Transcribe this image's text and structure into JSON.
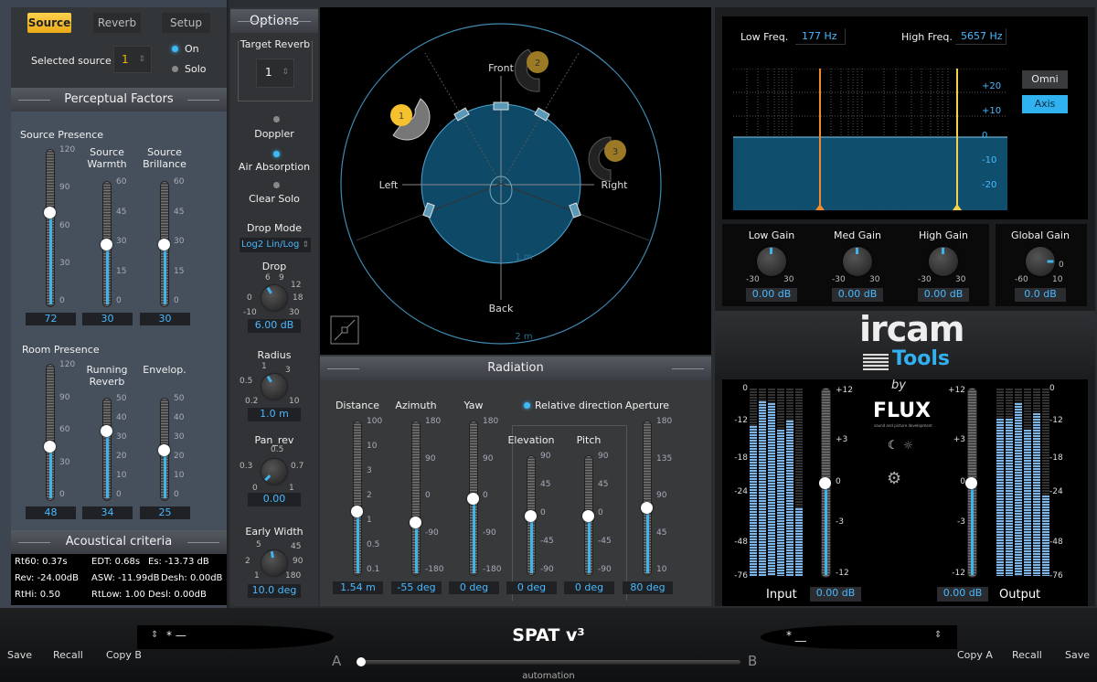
{
  "source_panel": {
    "tabs": [
      {
        "label": "Source",
        "active": true
      },
      {
        "label": "Reverb",
        "active": false
      },
      {
        "label": "Setup",
        "active": false
      }
    ],
    "selected_source_label": "Selected source",
    "selected_source_value": "1",
    "radio_on": "On",
    "radio_solo": "Solo",
    "perceptual_title": "Perceptual Factors",
    "sliders_top": [
      {
        "label": "Source Presence",
        "ticks": [
          "120",
          "90",
          "60",
          "30",
          "0"
        ],
        "value": "72",
        "fraction": 0.6
      },
      {
        "label": "Source Warmth",
        "ticks": [
          "60",
          "45",
          "30",
          "15",
          "0"
        ],
        "value": "30",
        "fraction": 0.5
      },
      {
        "label": "Source Brillance",
        "ticks": [
          "60",
          "45",
          "30",
          "15",
          "0"
        ],
        "value": "30",
        "fraction": 0.5
      }
    ],
    "sliders_bottom": [
      {
        "label": "Room Presence",
        "ticks": [
          "120",
          "90",
          "60",
          "30",
          "0"
        ],
        "value": "48",
        "fraction": 0.4
      },
      {
        "label": "Running Reverb",
        "ticks": [
          "50",
          "40",
          "30",
          "20",
          "10",
          "0"
        ],
        "value": "34",
        "fraction": 0.68
      },
      {
        "label": "Envelop.",
        "ticks": [
          "50",
          "40",
          "30",
          "20",
          "10",
          "0"
        ],
        "value": "25",
        "fraction": 0.5
      }
    ],
    "acoustical_title": "Acoustical criteria",
    "criteria": [
      [
        "Rt60: 0.37s",
        "EDT: 0.68s",
        "Es: -13.73 dB"
      ],
      [
        "Rev: -24.00dB",
        "ASW: -11.99dB",
        "Desh: 0.00dB"
      ],
      [
        "RtHi: 0.50",
        "RtLow: 1.00",
        "Desl: 0.00dB"
      ]
    ]
  },
  "options": {
    "title": "Options",
    "target_reverb_label": "Target Reverb",
    "target_reverb_value": "1",
    "doppler": "Doppler",
    "air_absorption": "Air Absorption",
    "clear_solo": "Clear Solo",
    "drop_mode_label": "Drop Mode",
    "drop_mode_value": "Log2 Lin/Log",
    "knobs": [
      {
        "label": "Drop",
        "ticks": [
          "6",
          "9",
          "0",
          "12",
          "18",
          "-10",
          "30"
        ],
        "value": "6.00 dB"
      },
      {
        "label": "Radius",
        "ticks": [
          "1",
          "3",
          "0.5",
          "0.2",
          "10"
        ],
        "value": "1.0 m"
      },
      {
        "label": "Pan_rev",
        "ticks": [
          "0.5",
          "0.3",
          "0.7",
          "0",
          "1"
        ],
        "value": "0.00"
      },
      {
        "label": "Early Width",
        "ticks": [
          "5",
          "45",
          "2",
          "90",
          "1",
          "180"
        ],
        "value": "10.0 deg"
      }
    ]
  },
  "spatial_view": {
    "labels": {
      "front": "Front",
      "back": "Back",
      "left": "Left",
      "right": "Right"
    },
    "ring_labels": [
      "1 m",
      "2 m"
    ],
    "sources": [
      "1",
      "2",
      "3"
    ]
  },
  "radiation": {
    "title": "Radiation",
    "relative_direction": "Relative direction",
    "sliders": [
      {
        "label": "Distance",
        "ticks": [
          "100",
          "10",
          "3",
          "2",
          "1",
          "0.5",
          "0.1"
        ],
        "value": "1.54 m",
        "fraction": 0.42
      },
      {
        "label": "Azimuth",
        "ticks": [
          "180",
          "90",
          "0",
          "-90",
          "-180"
        ],
        "value": "-55 deg",
        "fraction": 0.35
      },
      {
        "label": "Yaw",
        "ticks": [
          "180",
          "90",
          "0",
          "-90",
          "-180"
        ],
        "value": "0 deg",
        "fraction": 0.5
      },
      {
        "label": "Elevation",
        "ticks": [
          "90",
          "45",
          "0",
          "-45",
          "-90"
        ],
        "value": "0 deg",
        "fraction": 0.5
      },
      {
        "label": "Pitch",
        "ticks": [
          "90",
          "45",
          "0",
          "-45",
          "-90"
        ],
        "value": "0 deg",
        "fraction": 0.5
      },
      {
        "label": "Aperture",
        "ticks": [
          "180",
          "135",
          "90",
          "45",
          "10"
        ],
        "value": "80 deg",
        "fraction": 0.44
      }
    ]
  },
  "eq": {
    "low_freq_label": "Low Freq.",
    "low_freq_value": "177 Hz",
    "high_freq_label": "High Freq.",
    "high_freq_value": "5657 Hz",
    "db_ticks": [
      "+20",
      "+10",
      "0",
      "-10",
      "-20"
    ],
    "omni": "Omni",
    "axis": "Axis",
    "gains": [
      {
        "label": "Low Gain",
        "min": "-30",
        "max": "30",
        "value": "0.00 dB"
      },
      {
        "label": "Med Gain",
        "min": "-30",
        "max": "30",
        "value": "0.00 dB"
      },
      {
        "label": "High Gain",
        "min": "-30",
        "max": "30",
        "value": "0.00 dB"
      }
    ],
    "global_gain": {
      "label": "Global Gain",
      "min": "-60",
      "max": "10",
      "mid": "0",
      "value": "0.0 dB"
    }
  },
  "brand": {
    "ircam": "ircam",
    "tools": "Tools",
    "by": "by",
    "flux": "FLUX",
    "flux_sub": "sound and picture development"
  },
  "io": {
    "meter_ticks": [
      "0",
      "-12",
      "-18",
      "-24",
      "-48",
      "-76"
    ],
    "fader_ticks": [
      "+12",
      "+3",
      "0",
      "-3",
      "-12"
    ],
    "input_label": "Input",
    "input_value": "0.00 dB",
    "output_label": "Output",
    "output_value": "0.00 dB",
    "input_levels": [
      0.8,
      0.93,
      0.92,
      0.78,
      0.83,
      0.36
    ],
    "output_levels": [
      0.84,
      0.84,
      0.92,
      0.78,
      0.87,
      0.43
    ]
  },
  "bottom": {
    "left_buttons": [
      "Save",
      "Recall",
      "Copy B"
    ],
    "right_buttons": [
      "Copy A",
      "Recall",
      "Save"
    ],
    "preset_a": "* —",
    "preset_b": "* __",
    "title": "SPAT v³",
    "a": "A",
    "b": "B",
    "automation": "automation",
    "morph_fraction": 0.0
  }
}
